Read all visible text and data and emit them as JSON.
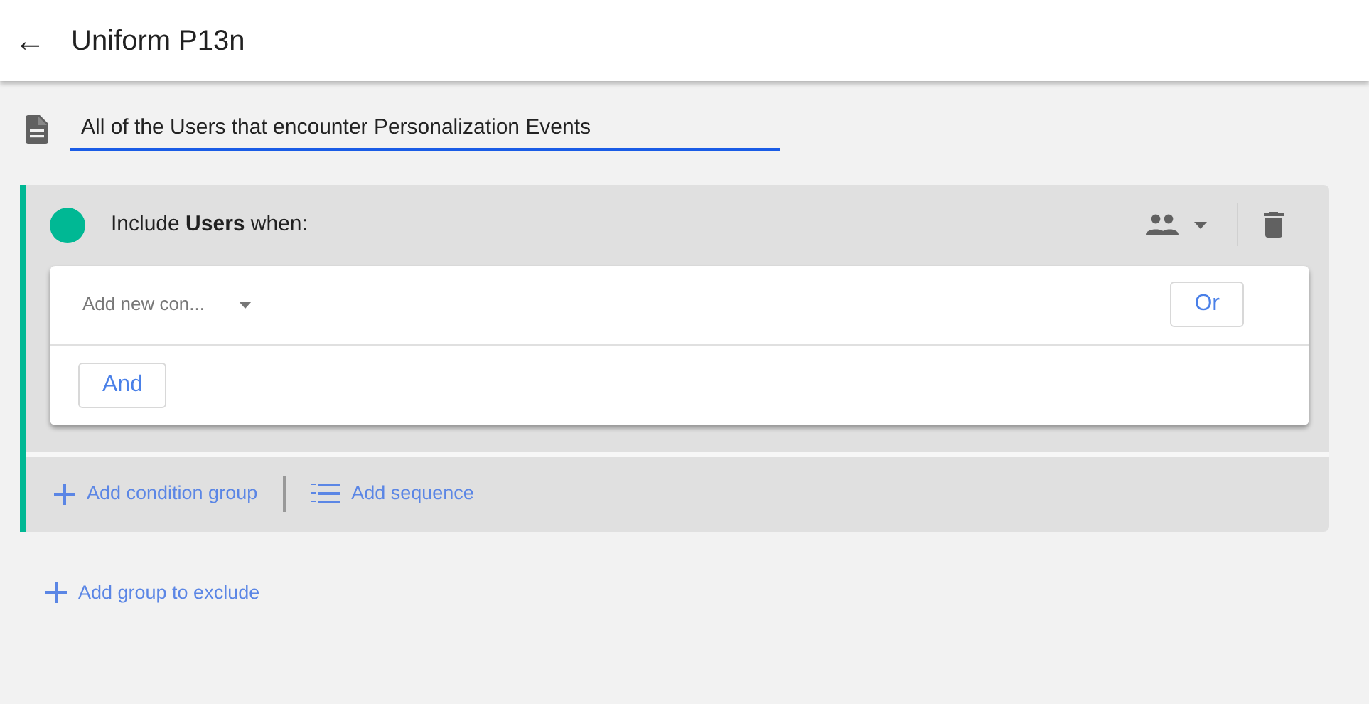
{
  "header": {
    "back_icon": "←",
    "title": "Uniform P13n"
  },
  "name_field": {
    "value": "All of the Users that encounter Personalization Events"
  },
  "include_group": {
    "color": "#00b894",
    "label": "Include **Users** when:",
    "condition": {
      "placeholder": "Add new con..."
    },
    "or_button": "Or",
    "and_button": "And",
    "actions": [
      "Add condition group",
      "Add sequence"
    ]
  },
  "exclude_action": "Add group to exclude"
}
